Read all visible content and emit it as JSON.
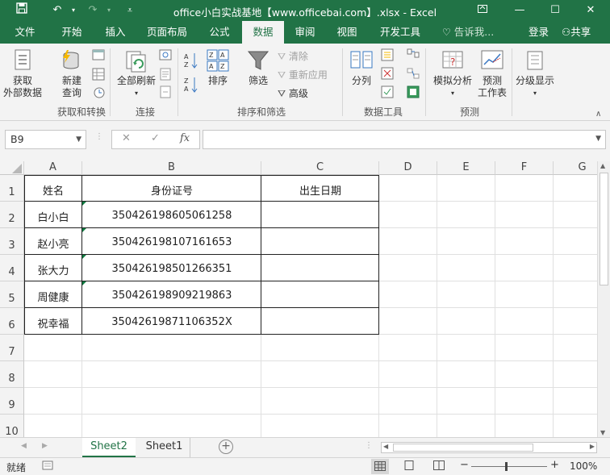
{
  "titlebar": {
    "title": "office小白实战基地【www.officebai.com】.xlsx - Excel",
    "icons": [
      "save-icon",
      "undo-icon",
      "redo-icon",
      "customize-icon"
    ]
  },
  "tabs": {
    "items": [
      "文件",
      "开始",
      "插入",
      "页面布局",
      "公式",
      "数据",
      "审阅",
      "视图",
      "开发工具"
    ],
    "active": "数据",
    "tell_me": "告诉我...",
    "login": "登录",
    "share": "共享"
  },
  "ribbon": {
    "get_external_data": "获取\n外部数据",
    "new_query": "新建\n查询",
    "group_get_transform": "获取和转换",
    "refresh_all": "全部刷新",
    "group_connections": "连接",
    "sort": "排序",
    "filter": "筛选",
    "clear": "清除",
    "reapply": "重新应用",
    "advanced": "高级",
    "group_sort_filter": "排序和筛选",
    "text_to_columns": "分列",
    "group_data_tools": "数据工具",
    "what_if": "模拟分析",
    "forecast_sheet": "预测\n工作表",
    "group_forecast": "预测",
    "outline": "分级显示"
  },
  "formula_bar": {
    "name_box": "B9",
    "cancel": "✕",
    "enter": "✓",
    "fx": "fx",
    "formula": ""
  },
  "grid": {
    "columns": [
      "A",
      "B",
      "C",
      "D",
      "E",
      "F",
      "G"
    ],
    "rows": [
      "1",
      "2",
      "3",
      "4",
      "5",
      "6",
      "7",
      "8",
      "9",
      "10"
    ],
    "headers": [
      "姓名",
      "身份证号",
      "出生日期"
    ],
    "data": [
      {
        "name": "白小白",
        "id": "350426198605061258",
        "birth": ""
      },
      {
        "name": "赵小亮",
        "id": "350426198107161653",
        "birth": ""
      },
      {
        "name": "张大力",
        "id": "350426198501266351",
        "birth": ""
      },
      {
        "name": "周健康",
        "id": "350426198909219863",
        "birth": ""
      },
      {
        "name": "祝幸福",
        "id": "35042619871106352X",
        "birth": ""
      }
    ]
  },
  "sheets": {
    "tabs": [
      "Sheet2",
      "Sheet1"
    ],
    "active": "Sheet2"
  },
  "status": {
    "ready": "就绪",
    "zoom": "100%"
  }
}
